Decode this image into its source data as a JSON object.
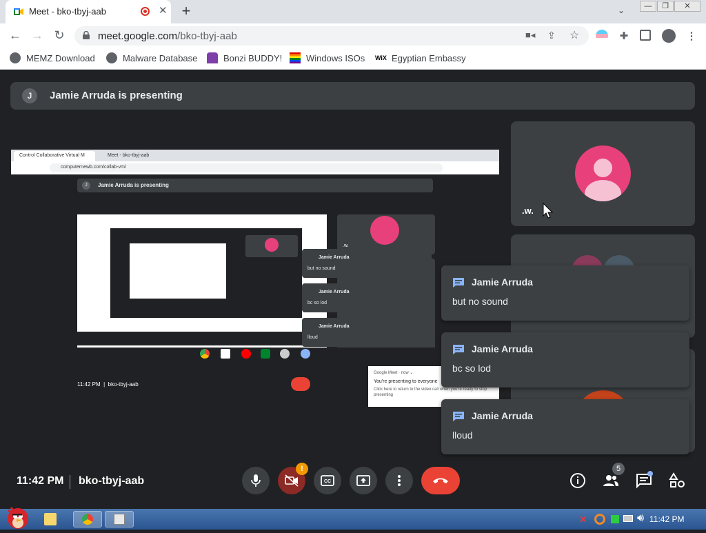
{
  "browser": {
    "tab_title": "Meet - bko-tbyj-aab",
    "new_tab_icon": "plus-icon",
    "url_domain": "meet.google.com",
    "url_path": "/bko-tbyj-aab",
    "bookmarks": [
      {
        "label": "MEMZ Download",
        "icon": "globe-icon"
      },
      {
        "label": "Malware Database",
        "icon": "globe-icon"
      },
      {
        "label": "Bonzi BUDDY!",
        "icon": "bonzi-icon"
      },
      {
        "label": "Windows ISOs",
        "icon": "rainbow-flag-icon"
      },
      {
        "label": "Egyptian Embassy",
        "icon": "wix-icon"
      }
    ]
  },
  "meet": {
    "presenter_initial": "J",
    "presenting_banner": "Jamie Arruda is presenting",
    "self_name": ".w.",
    "chat_messages": [
      {
        "author": "Jamie Arruda",
        "text": "but no sound"
      },
      {
        "author": "Jamie Arruda",
        "text": "bc so lod"
      },
      {
        "author": "Jamie Arruda",
        "text": "lloud"
      }
    ],
    "time": "11:42 PM",
    "meeting_code": "bko-tbyj-aab",
    "participants_count": "5",
    "camera_alert": "!",
    "colors": {
      "hangup": "#ea4335",
      "avatar": "#e8407a",
      "background": "#202124",
      "tile": "#3c4043"
    }
  },
  "shared_screen": {
    "tab1": "Control Collaborative Virtual M",
    "tab2": "Meet - bko-tbyj-aab",
    "url": "computernewb.com/collab-vm/",
    "banner": "Jamie Arruda is presenting",
    "self_name": ".w.",
    "chats": [
      {
        "author": "Jamie Arruda",
        "text": "but no sound"
      },
      {
        "author": "Jamie Arruda",
        "text": "bc so lod"
      },
      {
        "author": "Jamie Arruda",
        "text": "lloud"
      }
    ],
    "footer": "11:42 PM  |  bko-tbyj-aab",
    "notif_app": "Google Meet · now ⌄",
    "notif_title": "You're presenting to everyone",
    "notif_body": "Click here to return to the video call when you're ready to stop presenting"
  },
  "taskbar": {
    "clock": "11:42 PM"
  }
}
